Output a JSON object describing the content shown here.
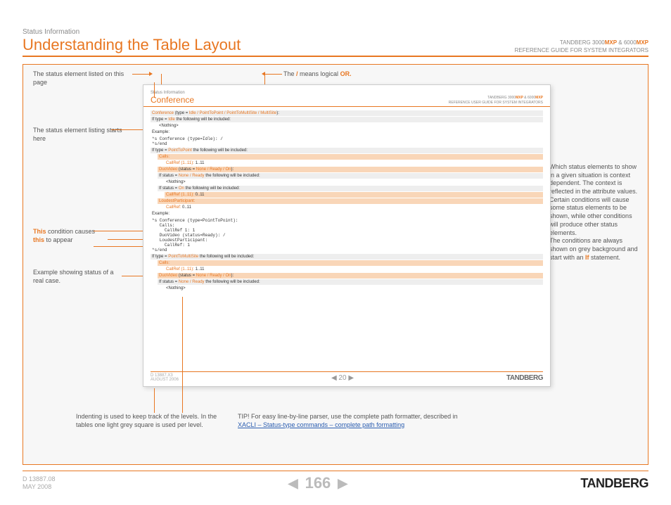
{
  "header": {
    "breadcrumb": "Status Information",
    "title": "Understanding the Table Layout",
    "prod_line1_a": "TANDBERG 3000",
    "mxp": "MXP",
    "amp": " & ",
    "prod_line1_b": "6000",
    "prod_line2": "REFERENCE GUIDE FOR SYSTEM INTEGRATORS"
  },
  "inner": {
    "bc": "Status Information",
    "title": "Conference",
    "prod_line1_a": "TANDBERG 3000",
    "prod_line1_b": "6000",
    "prod_line2": "REFERENCE USER GUIDE FOR SYSTEM INTEGRATORS",
    "row1_a": "Conference",
    "row1_b": " (type = ",
    "row1_c": "Idle / PointToPoint / PointToMultiSite / MultiSite",
    "row1_d": "):",
    "row2_a": "If type = ",
    "row2_b": "Idle",
    "row2_c": " the following will be included:",
    "row3": "<Nothing>",
    "row4": "Example:",
    "row5": "*s Conference (type=Idle): /\n*s/end",
    "row6_a": "If type = ",
    "row6_b": "PointToPoint",
    "row6_c": " the following will be included:",
    "row7": "Calls:",
    "row8_a": "CallRef (1..11): ",
    "row8_b": "1..11",
    "row9_a": "DuoVideo",
    "row9_b": " (status = ",
    "row9_c": "None / Ready / On",
    "row9_d": "):",
    "row10_a": "If status = ",
    "row10_b": "None / Ready",
    "row10_c": " the following will be included:",
    "row11": "<Nothing>",
    "row12_a": "If status = ",
    "row12_b": "On",
    "row12_c": " the following will be included:",
    "row13_a": "CallRef (1..11): ",
    "row13_b": "0..11",
    "row14": "LoudestParticipant:",
    "row15_a": "CallRef: ",
    "row15_b": "0..11",
    "row16": "Example:",
    "row17": "*s Conference (type=PointToPoint):\n   Calls:\n     CallRef 1: 1\n   DuoVideo (status=Ready): /\n   LoudestParticipant:\n     CallRef: 1\n*s/end",
    "row18_a": "If type = ",
    "row18_b": "PointToMultiSite",
    "row18_c": " the following will be included:",
    "row19": "Calls:",
    "row20_a": "CallRef (1..11): ",
    "row20_b": "1..11",
    "row21_a": "DuoVideo",
    "row21_b": " (status = ",
    "row21_c": "None / Ready / On",
    "row21_d": "):",
    "row22_a": "If status = ",
    "row22_b": "None / Ready",
    "row22_c": " the following will be included:",
    "row23": "<Nothing>",
    "footer_doc": "D 13887.X3\nAUGUST 2006",
    "footer_page": "20",
    "footer_brand": "TANDBERG"
  },
  "callouts": {
    "c1": "The status element listed on this page",
    "c2_a": "The ",
    "c2_b": "/",
    "c2_c": " means logical ",
    "c2_d": "OR.",
    "c3": "The status element listing starts here",
    "c4_a": "This",
    "c4_b": " condition causes ",
    "c4_c": "this",
    "c4_d": " to appear",
    "c5": "Example showing status of a real case.",
    "c6_a": "Which status elements to show in a given situation is context dependent. The context is reflected in the attribute values. Certain conditions will cause some status elements to be shown, while other conditions will produce other status elements.",
    "c6_b": "The conditions are always shown on grey background and start with an ",
    "c6_c": "If",
    "c6_d": " statement.",
    "c7": "Indenting is used to keep track of the levels. In the tables one light grey square is used per level.",
    "c8_a": "TIP!",
    "c8_b": " For easy line-by-line parser, use the complete path formatter, described in ",
    "c8_link": "XACLI – Status-type commands – complete path formatting"
  },
  "footer": {
    "doc_id": "D 13887.08",
    "date": "MAY 2008",
    "page": "166",
    "brand": "TANDBERG"
  }
}
